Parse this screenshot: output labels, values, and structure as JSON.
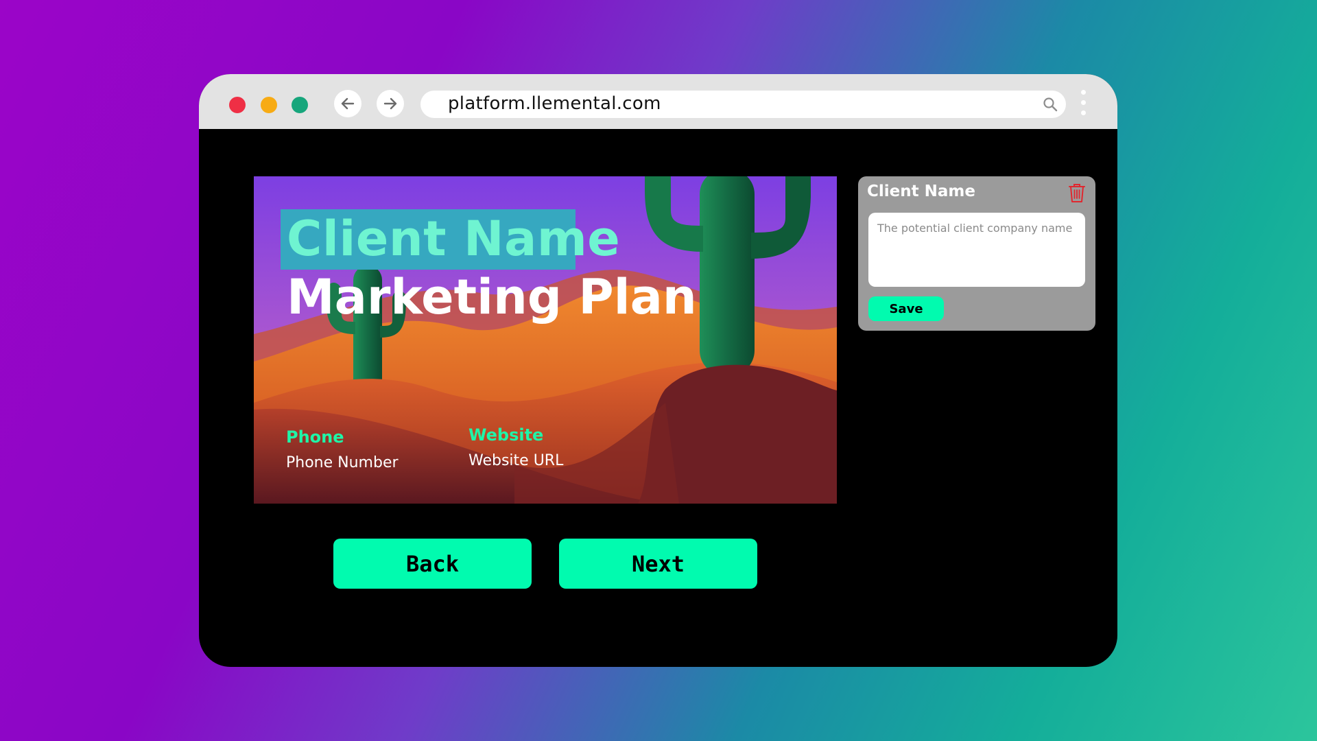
{
  "browser": {
    "url": "platform.llemental.com",
    "controls": {
      "close_color": "#ef2f45",
      "minimize_color": "#f7ab14",
      "maximize_color": "#17a67c"
    },
    "back_icon": "arrow-left-icon",
    "forward_icon": "arrow-right-icon",
    "search_icon": "search-icon",
    "menu_icon": "kebab-menu-icon"
  },
  "slide": {
    "client_name": "Client Name",
    "title": "Marketing Plan",
    "phone_label": "Phone",
    "phone_value": "Phone Number",
    "website_label": "Website",
    "website_value": "Website URL",
    "highlight_color": "#36a8c0",
    "accent_color": "#1ff5a8"
  },
  "navigation": {
    "back_label": "Back",
    "next_label": "Next",
    "button_color": "#01fbaf"
  },
  "editor_panel": {
    "title": "Client Name",
    "delete_icon": "trash-icon",
    "field_value": "",
    "field_placeholder": "The potential client company name",
    "save_label": "Save"
  }
}
